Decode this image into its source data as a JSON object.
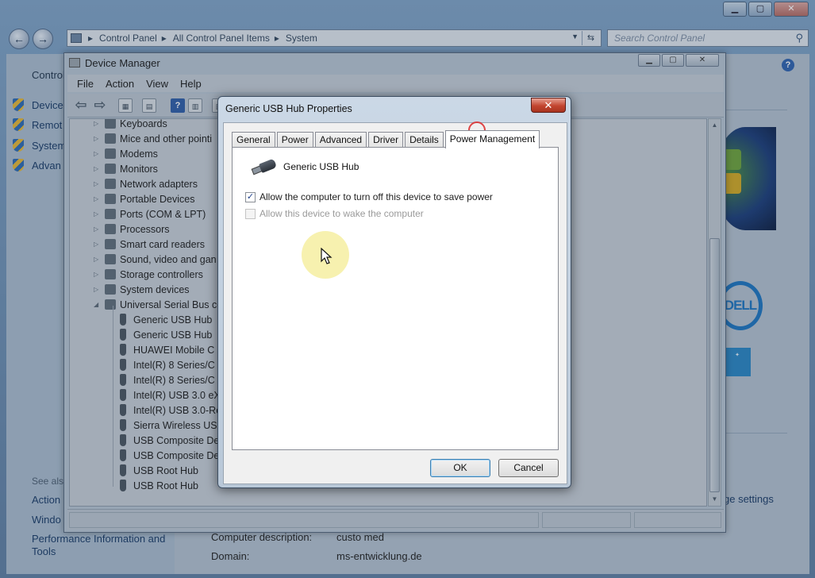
{
  "control_panel": {
    "breadcrumb": [
      "Control Panel",
      "All Control Panel Items",
      "System"
    ],
    "search_placeholder": "Search Control Panel",
    "side_title": "Control",
    "side_links": [
      "Device",
      "Remot",
      "System",
      "Advan"
    ],
    "see_also": "See als",
    "see_also_links": [
      "Action",
      "Windo",
      "Performance Information and",
      "Tools"
    ],
    "change_settings": "ge settings",
    "dell_text": "DELL",
    "rows": [
      {
        "label": "Computer description:",
        "value": "custo med"
      },
      {
        "label": "Domain:",
        "value": "ms-entwicklung.de"
      }
    ]
  },
  "device_manager": {
    "title": "Device Manager",
    "menu": [
      "File",
      "Action",
      "View",
      "Help"
    ],
    "categories": [
      "Keyboards",
      "Mice and other pointi",
      "Modems",
      "Monitors",
      "Network adapters",
      "Portable Devices",
      "Ports (COM & LPT)",
      "Processors",
      "Smart card readers",
      "Sound, video and gan",
      "Storage controllers",
      "System devices",
      "Universal Serial Bus co"
    ],
    "usb_children": [
      "Generic USB Hub",
      "Generic USB Hub",
      "HUAWEI Mobile C",
      "Intel(R) 8 Series/C",
      "Intel(R) 8 Series/C",
      "Intel(R) USB 3.0 eX",
      "Intel(R) USB 3.0-Ro",
      "Sierra Wireless USB",
      "USB Composite De",
      "USB Composite De",
      "USB Root Hub",
      "USB Root Hub"
    ]
  },
  "dialog": {
    "title": "Generic USB Hub Properties",
    "close_glyph": "✕",
    "tabs": [
      "General",
      "Power",
      "Advanced",
      "Driver",
      "Details",
      "Power Management"
    ],
    "active_tab": "Power Management",
    "device_name": "Generic USB Hub",
    "option_allow_turn_off": "Allow the computer to turn off this device to save power",
    "option_allow_turn_off_checked": true,
    "option_wake": "Allow this device to wake the computer",
    "option_wake_checked": false,
    "ok_label": "OK",
    "cancel_label": "Cancel"
  }
}
